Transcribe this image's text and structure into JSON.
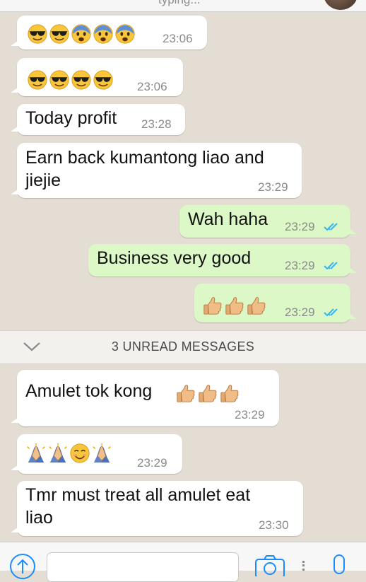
{
  "header": {
    "status": "typing..."
  },
  "messages": [
    {
      "dir": "in",
      "emojis": [
        "sunglasses-face",
        "sunglasses-face",
        "fearful-face",
        "fearful-face",
        "fearful-face"
      ],
      "time": "23:06"
    },
    {
      "dir": "in",
      "emojis": [
        "sunglasses-face",
        "sunglasses-face",
        "sunglasses-face",
        "sunglasses-face"
      ],
      "time": "23:06"
    },
    {
      "dir": "in",
      "text": "Today profit",
      "time": "23:28"
    },
    {
      "dir": "in",
      "lines": [
        "Earn back kumantong liao and",
        "jiejie"
      ],
      "time": "23:29"
    },
    {
      "dir": "out",
      "text": "Wah haha",
      "time": "23:29",
      "status": "read"
    },
    {
      "dir": "out",
      "text": "Business very good",
      "time": "23:29",
      "status": "read"
    },
    {
      "dir": "out",
      "emojis": [
        "thumbs-up",
        "thumbs-up",
        "thumbs-up"
      ],
      "time": "23:29",
      "status": "read"
    },
    {
      "dir": "in",
      "text": "Amulet tok kong",
      "emojis": [
        "thumbs-up",
        "thumbs-up",
        "thumbs-up"
      ],
      "time": "23:29"
    },
    {
      "dir": "in",
      "emojis": [
        "praying-hands",
        "praying-hands",
        "smiling-face",
        "praying-hands"
      ],
      "time": "23:29"
    },
    {
      "dir": "in",
      "lines": [
        "Tmr must treat all amulet eat",
        "liao"
      ],
      "time": "23:30"
    }
  ],
  "unread_divider": {
    "label": "3 UNREAD MESSAGES"
  },
  "input_bar": {
    "icons": [
      "share-arrow-icon",
      "camera-icon",
      "microphone-icon"
    ]
  },
  "colors": {
    "incoming": "#ffffff",
    "outgoing": "#dcf8c6",
    "background": "#e4ddd3",
    "read_ticks": "#34b7f1"
  }
}
